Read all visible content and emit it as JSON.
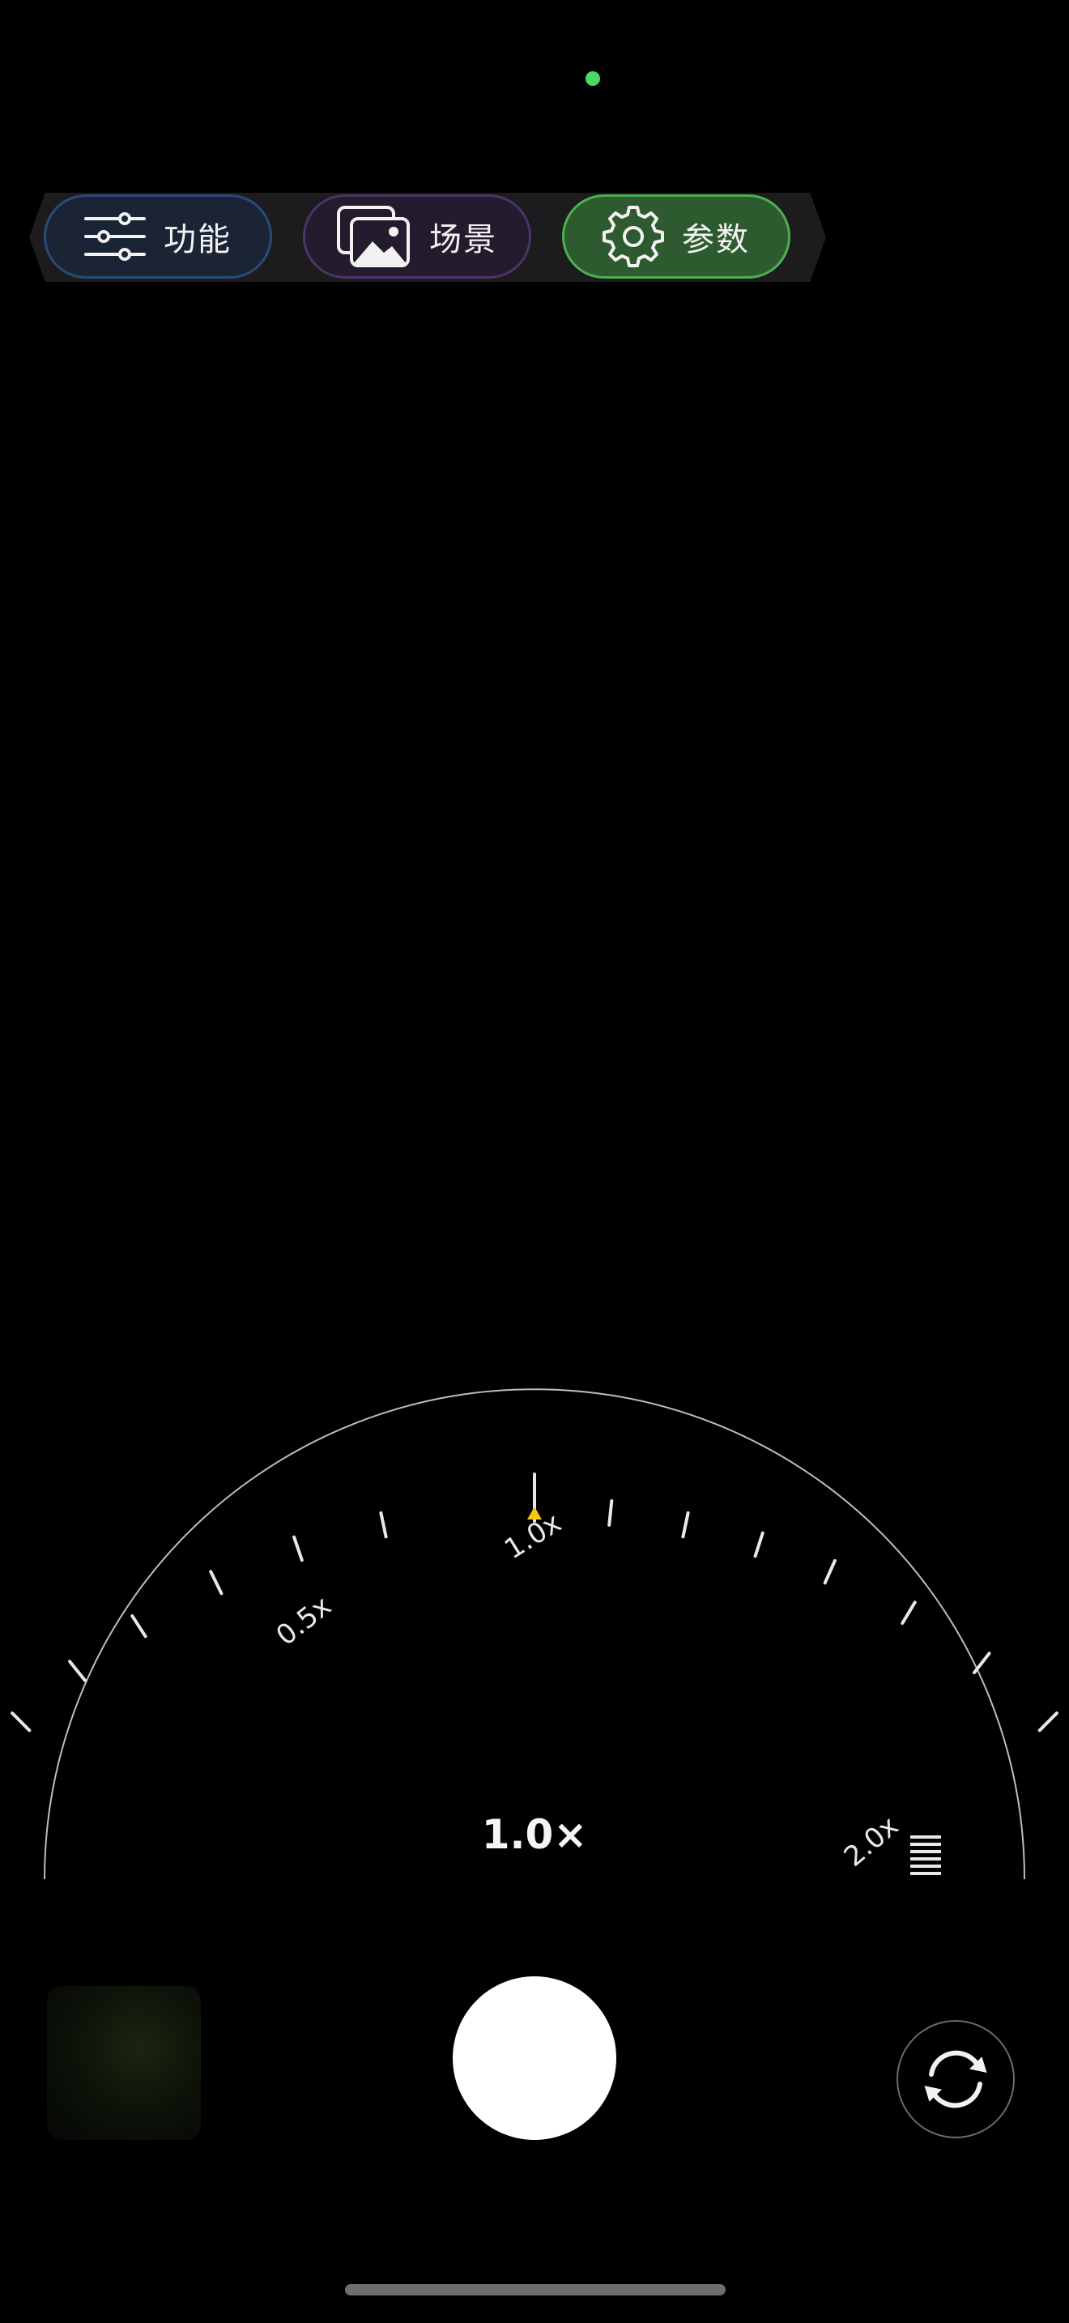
{
  "mode_tabs": [
    {
      "id": "func",
      "label": "功能",
      "icon": "sliders-icon",
      "accent": "#2a4a7a",
      "selected": false
    },
    {
      "id": "scene",
      "label": "场景",
      "icon": "photos-icon",
      "accent": "#4a3566",
      "selected": false
    },
    {
      "id": "param",
      "label": "参数",
      "icon": "gear-icon",
      "accent": "#4caf50",
      "selected": true
    }
  ],
  "zoom": {
    "current_label": "1.0×",
    "current_value": 1.0,
    "range": [
      0.5,
      2.0
    ],
    "scale_labels": [
      "0.5x",
      "1.0x",
      "2.0x"
    ],
    "indicator_color": "#f5c518"
  },
  "controls": {
    "shutter": "shutter-button",
    "flip": "camera-flip-icon",
    "gallery": "gallery-thumbnail"
  },
  "colors": {
    "background": "#000000",
    "privacy_indicator": "#4cd964",
    "dial_line": "#bdbdbd"
  }
}
